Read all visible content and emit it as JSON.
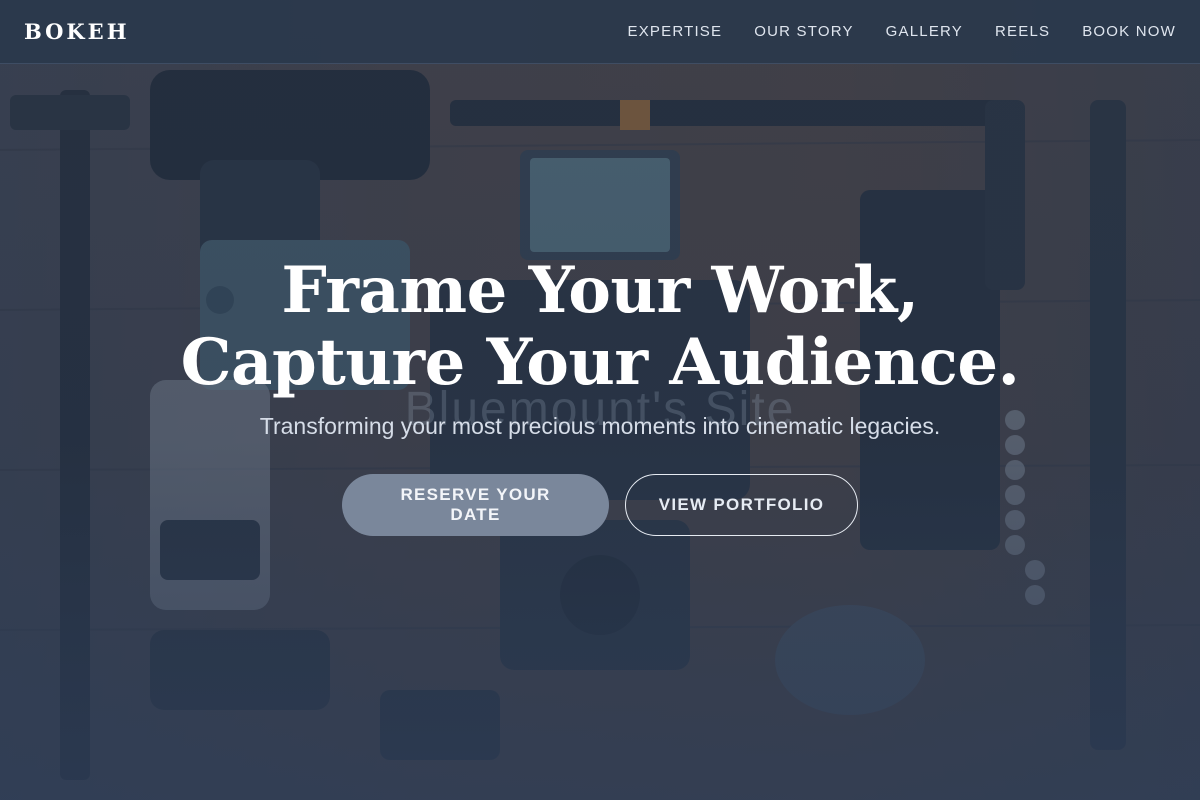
{
  "brand": {
    "name": "BOKEH"
  },
  "nav": {
    "items": [
      {
        "label": "EXPERTISE"
      },
      {
        "label": "OUR STORY"
      },
      {
        "label": "GALLERY"
      },
      {
        "label": "REELS"
      },
      {
        "label": "BOOK NOW"
      }
    ]
  },
  "hero": {
    "headline_line1": "Frame Your Work,",
    "headline_line2": "Capture Your Audience.",
    "watermark": "Bluemount's Site",
    "subheadline": "Transforming your most precious moments into cinematic legacies.",
    "primary_cta": "RESERVE YOUR DATE",
    "secondary_cta": "VIEW PORTFOLIO"
  },
  "colors": {
    "navbar_bg": "#2a384c",
    "overlay": "#26364e",
    "primary_button": "#7a879b",
    "text": "#ffffff"
  }
}
